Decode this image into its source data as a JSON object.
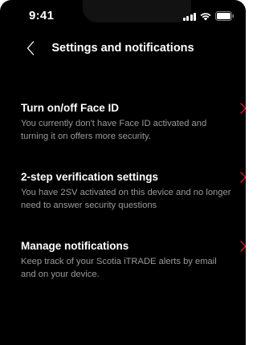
{
  "status_bar": {
    "time": "9:41"
  },
  "nav": {
    "title": "Settings and notifications"
  },
  "items": [
    {
      "title": "Turn on/off Face ID",
      "description": "You currently don't have Face ID activated and turning it on offers more security."
    },
    {
      "title": "2-step verification settings",
      "description": "You have 2SV activated on this device and no longer need to answer security questions"
    },
    {
      "title": "Manage notifications",
      "description": "Keep track of your Scotia iTRADE alerts by email and on your device."
    }
  ],
  "colors": {
    "background": "#000000",
    "text": "#ffffff",
    "secondary_text": "#9a9a9a",
    "accent": "#d21e2b"
  },
  "icons": {
    "back": "chevron-left-icon",
    "item_arrow": "chevron-right-icon",
    "signal": "cellular-signal-icon",
    "wifi": "wifi-icon",
    "battery": "battery-icon"
  }
}
